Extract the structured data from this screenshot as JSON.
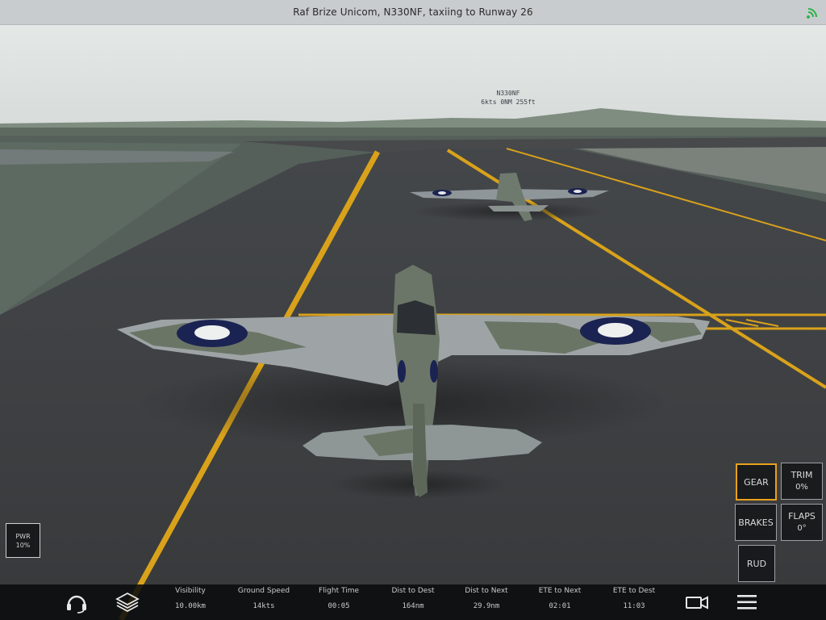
{
  "status_bar": {
    "title": "Raf Brize Unicom, N330NF, taxiing to Runway 26",
    "icon": "signal-icon",
    "icon_color": "#2db34a"
  },
  "aircraft_tag": {
    "callsign": "N330NF",
    "info": "6kts 0NM 255ft"
  },
  "controls": {
    "gear": {
      "label": "GEAR",
      "active_color": "#e8a21c"
    },
    "trim": {
      "label": "TRIM",
      "value": "0%"
    },
    "brakes": {
      "label": "BRAKES"
    },
    "flaps": {
      "label": "FLAPS",
      "value": "0°"
    },
    "rudder": {
      "label": "RUD"
    },
    "power": {
      "label": "PWR",
      "value": "10%"
    }
  },
  "bottom_bar": {
    "icons": [
      "headset-icon",
      "layers-icon",
      "camera-icon",
      "menu-icon"
    ],
    "stats": [
      {
        "label": "Visibility",
        "value": "10.00km"
      },
      {
        "label": "Ground Speed",
        "value": "14kts"
      },
      {
        "label": "Flight Time",
        "value": "00:05"
      },
      {
        "label": "Dist to Dest",
        "value": "164nm"
      },
      {
        "label": "Dist to Next",
        "value": "29.9nm"
      },
      {
        "label": "ETE to Next",
        "value": "02:01"
      },
      {
        "label": "ETE to Dest",
        "value": "11:03"
      }
    ]
  },
  "colors": {
    "sky": "#dfe4e3",
    "tarmac": "#3e4144",
    "taxi_line": "#d9a21a",
    "grass": "#5d665f"
  }
}
